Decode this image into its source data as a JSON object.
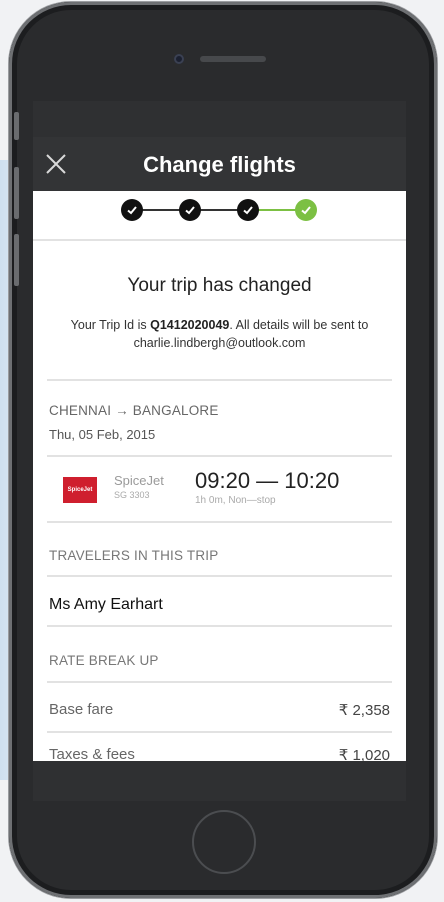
{
  "appbar": {
    "title": "Change flights"
  },
  "stepper": {
    "steps": 4,
    "current": 4
  },
  "confirmation": {
    "headline": "Your trip has changed",
    "trip_prefix": "Your Trip Id is ",
    "trip_id": "Q1412020049",
    "trip_suffix": ". All details will be sent to charlie.lindbergh@outlook.com"
  },
  "journey": {
    "route": "CHENNAI → BANGALORE",
    "date": "Thu, 05 Feb, 2015"
  },
  "flight": {
    "logo_text": "SpiceJet",
    "airline": "SpiceJet",
    "flight_no": "SG 3303",
    "times": "09:20 — 10:20",
    "duration": "1h 0m, Non—stop"
  },
  "travelers": {
    "label": "TRAVELERS IN THIS TRIP",
    "names": [
      "Ms Amy Earhart"
    ]
  },
  "rate": {
    "label": "RATE BREAK UP",
    "rows": [
      {
        "label": "Base fare",
        "amount": "₹ 2,358"
      },
      {
        "label": "Taxes & fees",
        "amount": "₹ 1,020"
      }
    ]
  },
  "colors": {
    "step_done": "#111111",
    "step_complete": "#7cc043",
    "appbar": "#333436"
  }
}
